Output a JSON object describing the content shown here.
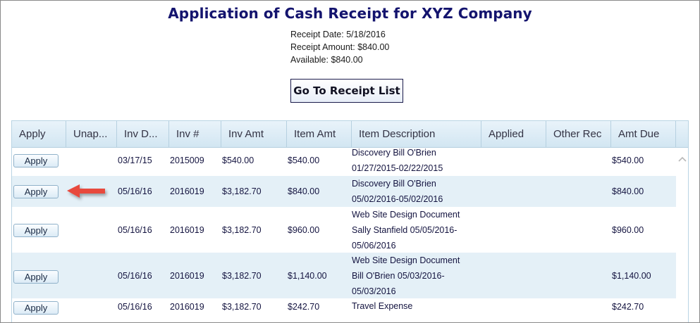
{
  "page": {
    "title": "Application of Cash Receipt for XYZ Company",
    "receipt_date": "Receipt Date: 5/18/2016",
    "receipt_amount": "Receipt Amount: $840.00",
    "available": "Available: $840.00",
    "goto_button": "Go To Receipt List"
  },
  "table": {
    "columns": [
      "Apply",
      "Unap...",
      "Inv D...",
      "Inv #",
      "Inv Amt",
      "Item Amt",
      "Item Description",
      "Applied",
      "Other Rec",
      "Amt Due"
    ],
    "apply_label": "Apply",
    "rows": [
      {
        "inv_date": "03/17/15",
        "inv_no": "2015009",
        "inv_amt": "$540.00",
        "item_amt": "$540.00",
        "desc": [
          "Discovery Bill O'Brien",
          "01/27/2015-02/22/2015"
        ],
        "amt_due": "$540.00"
      },
      {
        "inv_date": "05/16/16",
        "inv_no": "2016019",
        "inv_amt": "$3,182.70",
        "item_amt": "$840.00",
        "desc": [
          "Discovery Bill O'Brien",
          "05/02/2016-05/02/2016"
        ],
        "amt_due": "$840.00"
      },
      {
        "inv_date": "05/16/16",
        "inv_no": "2016019",
        "inv_amt": "$3,182.70",
        "item_amt": "$960.00",
        "desc": [
          "Web Site Design Document",
          "Sally Stanfield 05/05/2016-",
          "05/06/2016"
        ],
        "amt_due": "$960.00"
      },
      {
        "inv_date": "05/16/16",
        "inv_no": "2016019",
        "inv_amt": "$3,182.70",
        "item_amt": "$1,140.00",
        "desc": [
          "Web Site Design Document",
          "Bill O'Brien 05/03/2016-",
          "05/03/2016"
        ],
        "amt_due": "$1,140.00"
      },
      {
        "inv_date": "05/16/16",
        "inv_no": "2016019",
        "inv_amt": "$3,182.70",
        "item_amt": "$242.70",
        "desc": [
          "Travel Expense"
        ],
        "amt_due": "$242.70"
      }
    ]
  },
  "colors": {
    "title": "#14146e",
    "header_bg": "#d2e6f2",
    "alt_row": "#e4f0f7",
    "arrow": "#e8483c"
  },
  "icons": {
    "pointer_arrow": "red-arrow-icon",
    "scroll_up": "chevron-up-icon"
  }
}
